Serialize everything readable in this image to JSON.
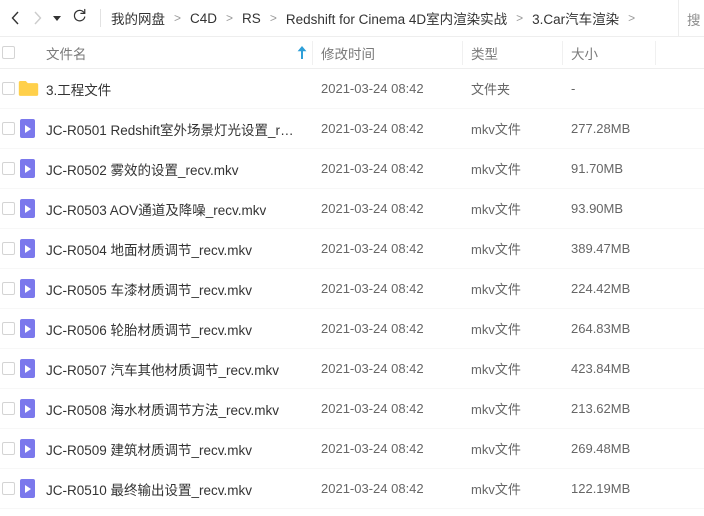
{
  "toolbar": {
    "back_icon": "chevron-left-icon",
    "forward_icon": "chevron-right-icon",
    "history_icon": "caret-down-icon",
    "refresh_icon": "refresh-icon",
    "search_label": "搜"
  },
  "breadcrumb": {
    "separator": ">",
    "items": [
      {
        "label": "我的网盘"
      },
      {
        "label": "C4D"
      },
      {
        "label": "RS"
      },
      {
        "label": "Redshift for Cinema 4D室内渲染实战"
      },
      {
        "label": "3.Car汽车渲染"
      }
    ]
  },
  "table": {
    "columns": {
      "name": "文件名",
      "mtime": "修改时间",
      "type": "类型",
      "size": "大小"
    },
    "sort": {
      "column": "name",
      "direction": "asc",
      "icon": "arrow-up-icon",
      "color": "#2e9fd8"
    },
    "rows": [
      {
        "icon": "folder-icon",
        "name": "3.工程文件",
        "mtime": "2021-03-24 08:42",
        "type": "文件夹",
        "size": "-"
      },
      {
        "icon": "video-file-icon",
        "name": "JC-R0501 Redshift室外场景灯光设置_recv....",
        "mtime": "2021-03-24 08:42",
        "type": "mkv文件",
        "size": "277.28MB"
      },
      {
        "icon": "video-file-icon",
        "name": "JC-R0502 雾效的设置_recv.mkv",
        "mtime": "2021-03-24 08:42",
        "type": "mkv文件",
        "size": "91.70MB"
      },
      {
        "icon": "video-file-icon",
        "name": "JC-R0503 AOV通道及降噪_recv.mkv",
        "mtime": "2021-03-24 08:42",
        "type": "mkv文件",
        "size": "93.90MB"
      },
      {
        "icon": "video-file-icon",
        "name": "JC-R0504 地面材质调节_recv.mkv",
        "mtime": "2021-03-24 08:42",
        "type": "mkv文件",
        "size": "389.47MB"
      },
      {
        "icon": "video-file-icon",
        "name": "JC-R0505 车漆材质调节_recv.mkv",
        "mtime": "2021-03-24 08:42",
        "type": "mkv文件",
        "size": "224.42MB"
      },
      {
        "icon": "video-file-icon",
        "name": "JC-R0506 轮胎材质调节_recv.mkv",
        "mtime": "2021-03-24 08:42",
        "type": "mkv文件",
        "size": "264.83MB"
      },
      {
        "icon": "video-file-icon",
        "name": "JC-R0507 汽车其他材质调节_recv.mkv",
        "mtime": "2021-03-24 08:42",
        "type": "mkv文件",
        "size": "423.84MB"
      },
      {
        "icon": "video-file-icon",
        "name": "JC-R0508 海水材质调节方法_recv.mkv",
        "mtime": "2021-03-24 08:42",
        "type": "mkv文件",
        "size": "213.62MB"
      },
      {
        "icon": "video-file-icon",
        "name": "JC-R0509 建筑材质调节_recv.mkv",
        "mtime": "2021-03-24 08:42",
        "type": "mkv文件",
        "size": "269.48MB"
      },
      {
        "icon": "video-file-icon",
        "name": "JC-R0510 最终输出设置_recv.mkv",
        "mtime": "2021-03-24 08:42",
        "type": "mkv文件",
        "size": "122.19MB"
      }
    ]
  },
  "colors": {
    "folder": "#ffd04b",
    "video": "#7b78ec",
    "accent": "#2e9fd8",
    "text": "#333333",
    "muted": "#666666"
  }
}
